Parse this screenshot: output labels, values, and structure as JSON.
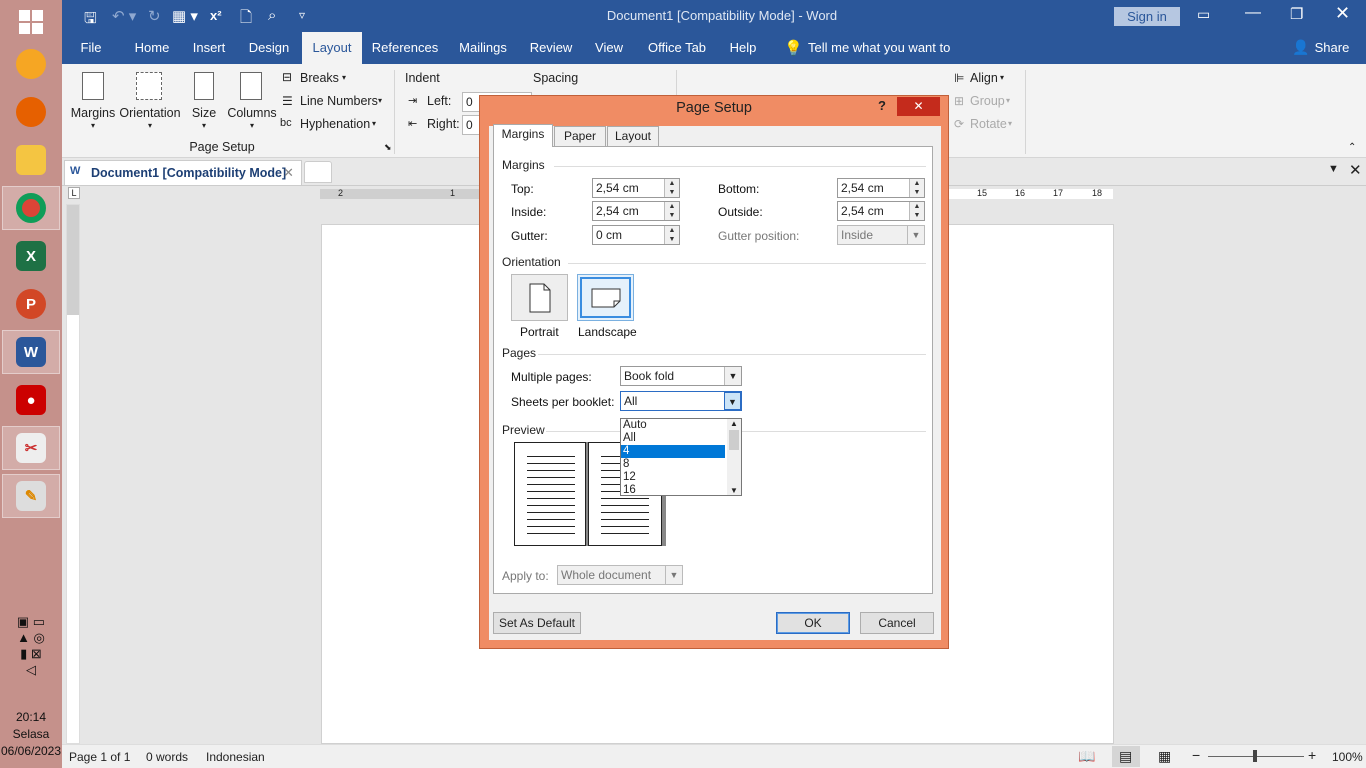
{
  "window": {
    "title": "Document1 [Compatibility Mode]  -  Word",
    "sign_in": "Sign in"
  },
  "ribbon_tabs": [
    "File",
    "Home",
    "Insert",
    "Design",
    "Layout",
    "References",
    "Mailings",
    "Review",
    "View",
    "Office Tab",
    "Help"
  ],
  "tell_me": "Tell me what you want to do",
  "share": "Share",
  "ribbon": {
    "margins": "Margins",
    "orientation": "Orientation",
    "size": "Size",
    "columns": "Columns",
    "breaks": "Breaks",
    "line_numbers": "Line Numbers",
    "hyphenation": "Hyphenation",
    "group_page_setup": "Page Setup",
    "indent": "Indent",
    "spacing": "Spacing",
    "left": "Left:",
    "right": "Right:",
    "align": "Align",
    "group": "Group",
    "rotate": "Rotate"
  },
  "doc_tab": "Document1 [Compatibility Mode]",
  "dialog": {
    "title": "Page Setup",
    "help": "?",
    "tabs": [
      "Margins",
      "Paper",
      "Layout"
    ],
    "margins_group": "Margins",
    "top_label": "Top:",
    "top_value": "2,54 cm",
    "bottom_label": "Bottom:",
    "bottom_value": "2,54 cm",
    "inside_label": "Inside:",
    "inside_value": "2,54 cm",
    "outside_label": "Outside:",
    "outside_value": "2,54 cm",
    "gutter_label": "Gutter:",
    "gutter_value": "0 cm",
    "gutter_pos_label": "Gutter position:",
    "gutter_pos_value": "Inside",
    "orientation_group": "Orientation",
    "portrait": "Portrait",
    "landscape": "Landscape",
    "pages_group": "Pages",
    "multiple_pages_label": "Multiple pages:",
    "multiple_pages_value": "Book fold",
    "sheets_label": "Sheets per booklet:",
    "sheets_value": "All",
    "sheets_options": [
      "Auto",
      "All",
      "4",
      "8",
      "12",
      "16"
    ],
    "sheets_highlighted": "4",
    "preview_group": "Preview",
    "apply_to_label": "Apply to:",
    "apply_to_value": "Whole document",
    "set_default": "Set As Default",
    "ok": "OK",
    "cancel": "Cancel"
  },
  "status": {
    "page": "Page 1 of 1",
    "words": "0 words",
    "language": "Indonesian",
    "zoom": "100%"
  },
  "tray": {
    "time": "20:14",
    "day": "Selasa",
    "date": "06/06/2023"
  },
  "ruler_top_left": [
    "2",
    "1"
  ],
  "ruler_top_right": [
    "15",
    "16",
    "17",
    "18"
  ],
  "colors": {
    "word_blue": "#2b579a",
    "dialog_frame": "#f08c64",
    "taskbar": "#c5918b",
    "highlight": "#0078d7"
  }
}
